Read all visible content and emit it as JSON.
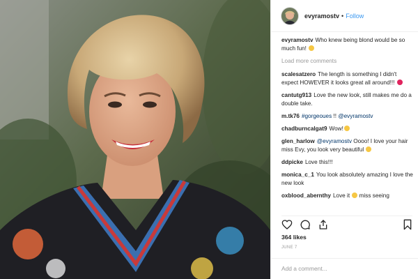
{
  "post": {
    "username": "evyramostv",
    "separator": "•",
    "follow_label": "Follow",
    "caption": "Who knew being blond would be so much fun!",
    "load_more": "Load more comments",
    "comments": [
      {
        "user": "scalesatzero",
        "text": "The length is something I didn't expect HOWEVER it looks great all around!!!",
        "emoji": "heart"
      },
      {
        "user": "cantutg913",
        "text": "Love the new look, still makes me do a double take.",
        "emoji": ""
      },
      {
        "user": "m.tk76",
        "hashtag": "#gorgeoues",
        "text_mid": " !! ",
        "mention": "@evyramostv"
      },
      {
        "user": "chadburncalgat9",
        "text": "Wow!",
        "emoji": "face"
      },
      {
        "user": "glen_harlow",
        "mention": "@evyramostv",
        "text": " Oooo! I love your hair miss Evy, you look very beautiful",
        "emoji": "face"
      },
      {
        "user": "ddpicke",
        "text": "Love this!!!",
        "emoji": ""
      },
      {
        "user": "monica_c_1",
        "text": "You look absolutely amazing I love the new look",
        "emoji": ""
      },
      {
        "user": "oxblood_abernthy",
        "text": "Love it",
        "emoji": "face",
        "text2": "miss seeing"
      }
    ],
    "likes": "364 likes",
    "date": "JUNE 7",
    "add_comment_placeholder": "Add a comment..."
  },
  "icons": {
    "like": "heart-icon",
    "comment": "comment-icon",
    "share": "share-icon",
    "save": "bookmark-icon",
    "avatar": "avatar"
  },
  "colors": {
    "link_blue": "#3897f0",
    "hashtag": "#003569",
    "muted": "#999999",
    "text": "#262626"
  }
}
